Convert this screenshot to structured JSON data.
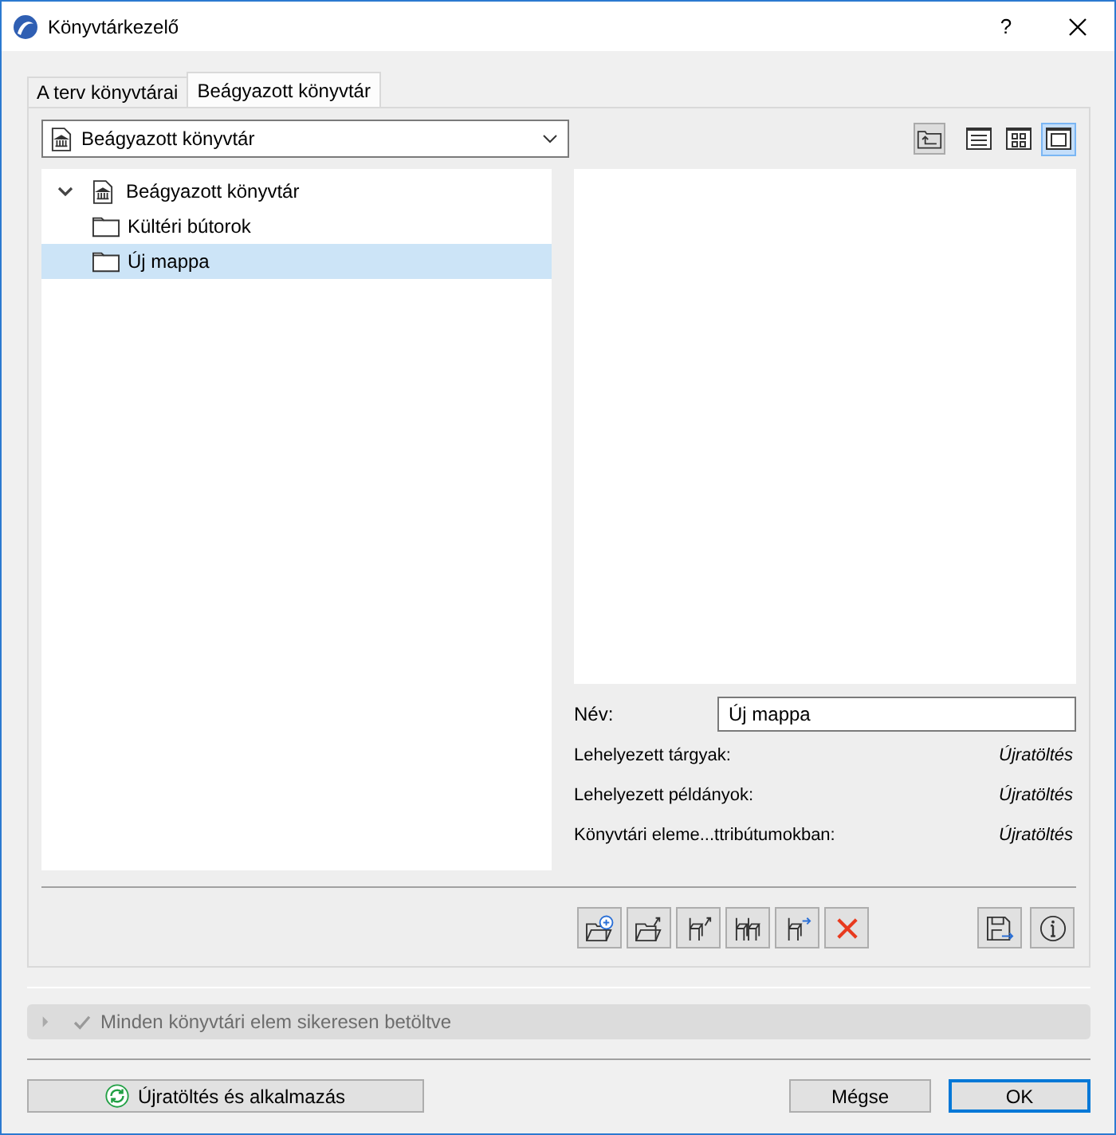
{
  "window": {
    "title": "Könyvtárkezelő",
    "help": "?"
  },
  "tabs": [
    {
      "label": "A terv könyvtárai",
      "selected": false
    },
    {
      "label": "Beágyazott könyvtár",
      "selected": true
    }
  ],
  "library_dropdown": {
    "value": "Beágyazott könyvtár"
  },
  "view_modes": [
    {
      "kind": "list",
      "selected": false
    },
    {
      "kind": "grid",
      "selected": false
    },
    {
      "kind": "preview",
      "selected": true
    }
  ],
  "tree": [
    {
      "label": "Beágyazott könyvtár",
      "kind": "library",
      "expanded": true,
      "selected": false,
      "children": [
        {
          "label": "Kültéri bútorok",
          "kind": "folder",
          "selected": false
        },
        {
          "label": "Új mappa",
          "kind": "folder",
          "selected": true
        }
      ]
    }
  ],
  "details": {
    "name_label": "Név:",
    "name_value": "Új mappa",
    "rows": [
      {
        "label": "Lehelyezett tárgyak:",
        "value": "Újratöltés"
      },
      {
        "label": "Lehelyezett példányok:",
        "value": "Újratöltés"
      },
      {
        "label": "Könyvtári eleme...ttribútumokban:",
        "value": "Újratöltés"
      }
    ]
  },
  "status": {
    "message": "Minden könyvtári elem sikeresen betöltve",
    "expanded": false
  },
  "footer": {
    "reload_button": "Újratöltés és alkalmazás",
    "buttons": [
      {
        "label": "Mégse",
        "default": false
      },
      {
        "label": "OK",
        "default": true
      }
    ]
  }
}
